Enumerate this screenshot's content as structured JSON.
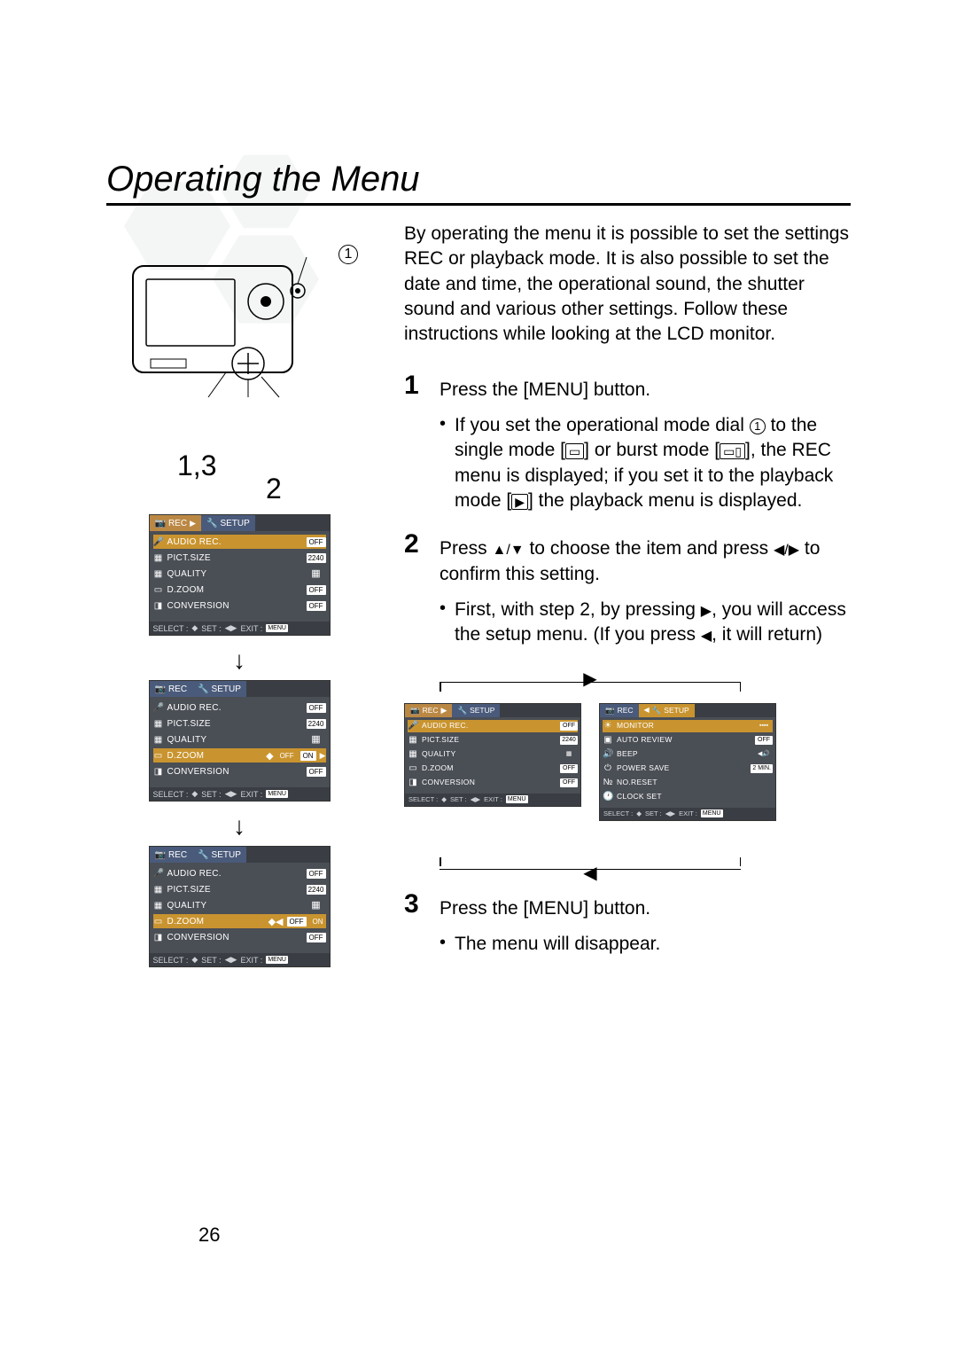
{
  "page_number": "26",
  "title": "Operating the Menu",
  "camera_callouts": {
    "top": "1",
    "bottom_left": "1,3",
    "bottom_right": "2"
  },
  "menus": {
    "tabs": {
      "rec": "REC",
      "setup": "SETUP"
    },
    "items": {
      "audio_rec": "AUDIO REC.",
      "pict_size": "PICT.SIZE",
      "quality": "QUALITY",
      "dzoom": "D.ZOOM",
      "conversion": "CONVERSION"
    },
    "vals": {
      "off": "OFF",
      "on": "ON",
      "size": "2240"
    },
    "footer": {
      "select": "SELECT :",
      "set": "SET :",
      "exit": "EXIT :",
      "menu": "MENU"
    }
  },
  "setup_items": {
    "monitor": "MONITOR",
    "auto_review": "AUTO REVIEW",
    "beep": "BEEP",
    "power_save": "POWER SAVE",
    "no_reset": "NO.RESET",
    "clock_set": "CLOCK SET",
    "vals": {
      "off": "OFF",
      "two_min": "2 MIN."
    }
  },
  "intro": "By operating the menu it is possible to set the settings REC or playback mode. It is also possible to set the date and time, the operational sound, the shutter sound and various other settings. Follow these instructions while looking at the LCD monitor.",
  "steps": {
    "s1": {
      "num": "1",
      "text": "Press the [MENU] button.",
      "bullet_pre": "If you set the operational mode dial ",
      "bullet_mid1": " to the single mode [",
      "bullet_mid2": "] or burst mode [",
      "bullet_mid3": "], the REC menu is displayed; if you set it to the playback mode [",
      "bullet_end": "] the playback menu is displayed."
    },
    "s2": {
      "num": "2",
      "text_pre": "Press ",
      "text_mid": " to choose the item and press ",
      "text_end": " to confirm this setting.",
      "bullet_pre": "First, with step 2, by pressing ",
      "bullet_mid": ", you will access the setup menu. (If you press ",
      "bullet_end": ", it will return)"
    },
    "s3": {
      "num": "3",
      "text": "Press the [MENU] button.",
      "bullet": "The menu will disappear."
    }
  }
}
